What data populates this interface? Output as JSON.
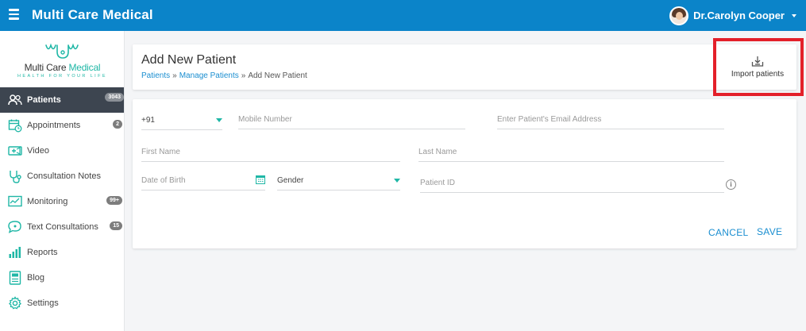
{
  "app": {
    "title": "Multi Care Medical",
    "user_name": "Dr.Carolyn Cooper"
  },
  "logo": {
    "name_part1": "Multi Care ",
    "name_part2": "Medical",
    "tagline": "HEALTH FOR YOUR LIFE"
  },
  "sidebar": {
    "items": [
      {
        "label": "Patients",
        "badge": "3043",
        "icon": "patients-icon",
        "active": true
      },
      {
        "label": "Appointments",
        "badge": "2",
        "icon": "calendar-icon"
      },
      {
        "label": "Video",
        "badge": "",
        "icon": "video-icon"
      },
      {
        "label": "Consultation Notes",
        "badge": "",
        "icon": "stethoscope-icon"
      },
      {
        "label": "Monitoring",
        "badge": "99+",
        "icon": "monitoring-icon"
      },
      {
        "label": "Text Consultations",
        "badge": "15",
        "icon": "chat-icon"
      },
      {
        "label": "Reports",
        "badge": "",
        "icon": "reports-icon"
      },
      {
        "label": "Blog",
        "badge": "",
        "icon": "blog-icon"
      },
      {
        "label": "Settings",
        "badge": "",
        "icon": "gear-icon"
      }
    ]
  },
  "header": {
    "title": "Add New Patient",
    "breadcrumb": [
      "Patients",
      "Manage Patients",
      "Add New Patient"
    ],
    "separator": "»",
    "import_label": "Import patients"
  },
  "form": {
    "country_code": "+91",
    "mobile_placeholder": "Mobile Number",
    "email_placeholder": "Enter Patient's Email Address",
    "first_name_placeholder": "First Name",
    "last_name_placeholder": "Last Name",
    "dob_placeholder": "Date of Birth",
    "gender_value": "Gender",
    "patient_id_placeholder": "Patient ID",
    "info_symbol": "i",
    "cancel_label": "CANCEL",
    "save_label": "SAVE"
  },
  "colors": {
    "topbar": "#0b84c9",
    "accent": "#1fb7a6",
    "link": "#1a8ed0",
    "sidebar_active": "#3d4550",
    "highlight_box": "#e3202a"
  }
}
